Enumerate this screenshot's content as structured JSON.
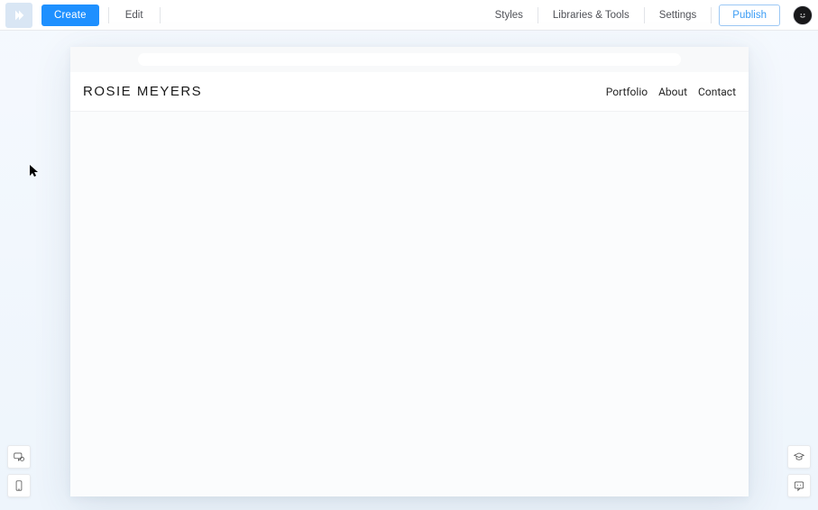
{
  "toolbar": {
    "create_label": "Create",
    "edit_label": "Edit",
    "styles_label": "Styles",
    "libraries_label": "Libraries & Tools",
    "settings_label": "Settings",
    "publish_label": "Publish"
  },
  "site": {
    "title": "ROSIE MEYERS",
    "nav": {
      "portfolio": "Portfolio",
      "about": "About",
      "contact": "Contact"
    }
  }
}
